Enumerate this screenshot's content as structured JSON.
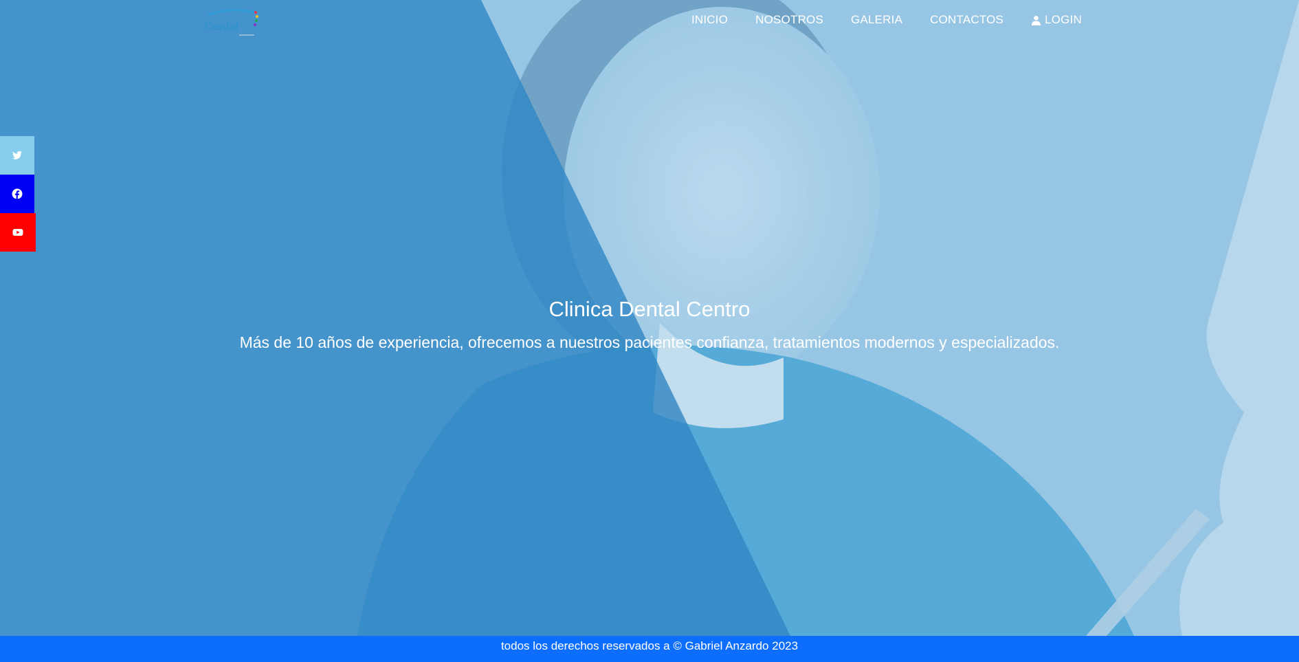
{
  "nav": {
    "logo_alt": "Dental",
    "items": [
      {
        "label": "INICIO"
      },
      {
        "label": "NOSOTROS"
      },
      {
        "label": "GALERIA"
      },
      {
        "label": "CONTACTOS"
      },
      {
        "label": "LOGIN",
        "icon": "user-icon"
      }
    ]
  },
  "social": [
    {
      "name": "twitter",
      "icon": "twitter-icon",
      "color": "#87cdee"
    },
    {
      "name": "facebook",
      "icon": "facebook-icon",
      "color": "#0000f4"
    },
    {
      "name": "youtube",
      "icon": "youtube-icon",
      "color": "#ff0000"
    }
  ],
  "hero": {
    "title": "Clinica Dental Centro",
    "subtitle": "Más de 10 años de experiencia, ofrecemos a nuestros pacientes confianza, tratamientos modernos y especializados."
  },
  "footer": {
    "text": "todos los derechos reservados a © Gabriel Anzardo 2023"
  },
  "colors": {
    "overlay": "#2f86c4",
    "footer_bg": "#0d6efd"
  }
}
